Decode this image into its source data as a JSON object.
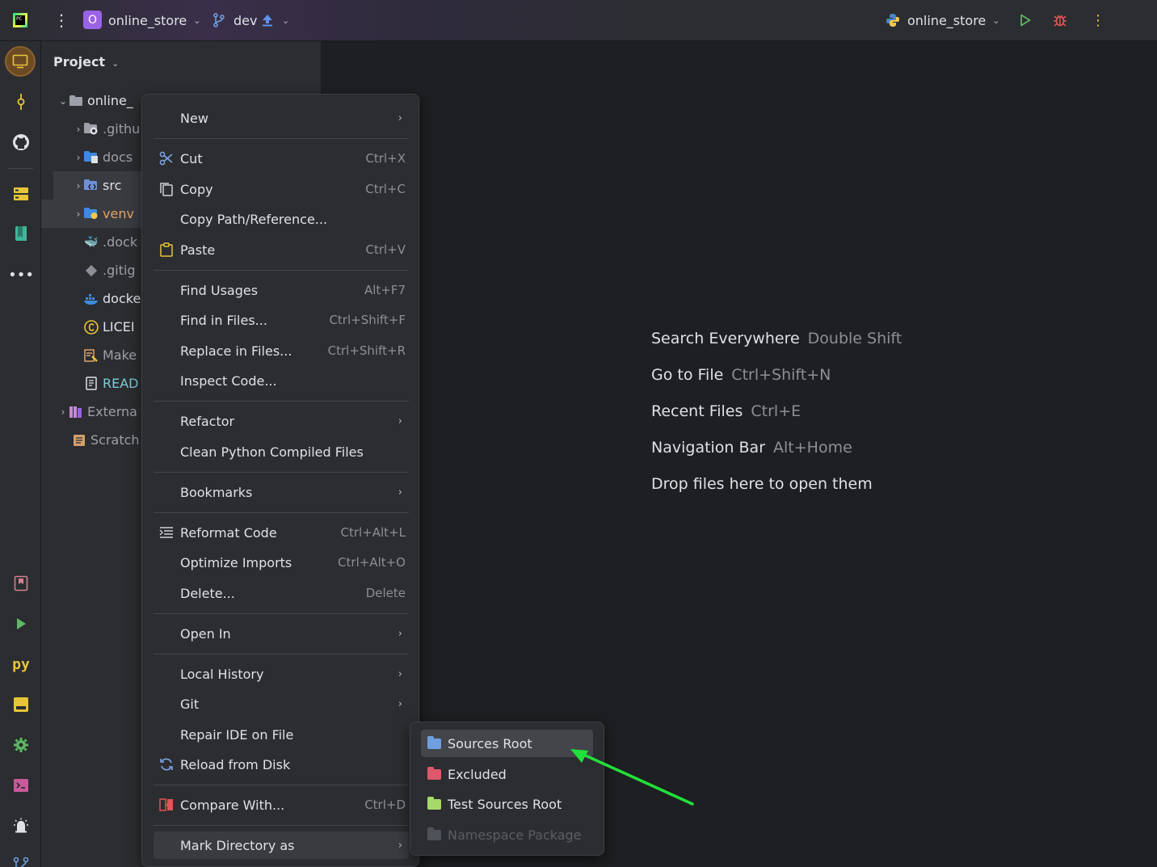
{
  "topbar": {
    "project_badge": "O",
    "project_name": "online_store",
    "branch": "dev",
    "run_config": "online_store"
  },
  "project_panel": {
    "title": "Project",
    "tree": [
      {
        "label": "online_",
        "icon": "folder-icon"
      },
      {
        "label": ".githu",
        "icon": "github-folder-icon"
      },
      {
        "label": "docs",
        "icon": "docs-folder-icon"
      },
      {
        "label": "src",
        "icon": "source-folder-icon"
      },
      {
        "label": "venv",
        "icon": "venv-folder-icon"
      },
      {
        "label": ".dock",
        "icon": "docker-icon"
      },
      {
        "label": ".gitig",
        "icon": "git-icon"
      },
      {
        "label": "docke",
        "icon": "docker-icon"
      },
      {
        "label": "LICEI",
        "icon": "license-icon"
      },
      {
        "label": "Make",
        "icon": "makefile-icon"
      },
      {
        "label": "READ",
        "icon": "readme-icon"
      },
      {
        "label": "Externa",
        "icon": "library-icon"
      },
      {
        "label": "Scratch",
        "icon": "scratch-icon"
      }
    ]
  },
  "editor_hints": [
    {
      "label": "Search Everywhere",
      "key": "Double Shift"
    },
    {
      "label": "Go to File",
      "key": "Ctrl+Shift+N"
    },
    {
      "label": "Recent Files",
      "key": "Ctrl+E"
    },
    {
      "label": "Navigation Bar",
      "key": "Alt+Home"
    },
    {
      "label": "Drop files here to open them",
      "key": ""
    }
  ],
  "context_menu": [
    {
      "label": "New",
      "shortcut": "",
      "submenu": true
    },
    {
      "label": "Cut",
      "shortcut": "Ctrl+X",
      "icon": "scissors-icon"
    },
    {
      "label": "Copy",
      "shortcut": "Ctrl+C",
      "icon": "copy-icon"
    },
    {
      "label": "Copy Path/Reference...",
      "shortcut": ""
    },
    {
      "label": "Paste",
      "shortcut": "Ctrl+V",
      "icon": "paste-icon"
    },
    {
      "label": "Find Usages",
      "shortcut": "Alt+F7"
    },
    {
      "label": "Find in Files...",
      "shortcut": "Ctrl+Shift+F"
    },
    {
      "label": "Replace in Files...",
      "shortcut": "Ctrl+Shift+R"
    },
    {
      "label": "Inspect Code...",
      "shortcut": ""
    },
    {
      "label": "Refactor",
      "shortcut": "",
      "submenu": true
    },
    {
      "label": "Clean Python Compiled Files",
      "shortcut": ""
    },
    {
      "label": "Bookmarks",
      "shortcut": "",
      "submenu": true
    },
    {
      "label": "Reformat Code",
      "shortcut": "Ctrl+Alt+L",
      "icon": "reformat-icon"
    },
    {
      "label": "Optimize Imports",
      "shortcut": "Ctrl+Alt+O"
    },
    {
      "label": "Delete...",
      "shortcut": "Delete"
    },
    {
      "label": "Open In",
      "shortcut": "",
      "submenu": true
    },
    {
      "label": "Local History",
      "shortcut": "",
      "submenu": true
    },
    {
      "label": "Git",
      "shortcut": "",
      "submenu": true
    },
    {
      "label": "Repair IDE on File",
      "shortcut": ""
    },
    {
      "label": "Reload from Disk",
      "shortcut": "",
      "icon": "reload-icon"
    },
    {
      "label": "Compare With...",
      "shortcut": "Ctrl+D",
      "icon": "compare-icon"
    },
    {
      "label": "Mark Directory as",
      "shortcut": "",
      "submenu": true
    }
  ],
  "submenu": [
    {
      "label": "Sources Root",
      "color": "#6f9fe0"
    },
    {
      "label": "Excluded",
      "color": "#e0586b"
    },
    {
      "label": "Test Sources Root",
      "color": "#a6d96a"
    },
    {
      "label": "Namespace Package",
      "color": "#4e5157",
      "disabled": true
    }
  ],
  "colors": {
    "accent_purple": "#9a62e6",
    "run_green": "#5fb865",
    "debug_red": "#e05555",
    "arrow_green": "#22e03a"
  }
}
